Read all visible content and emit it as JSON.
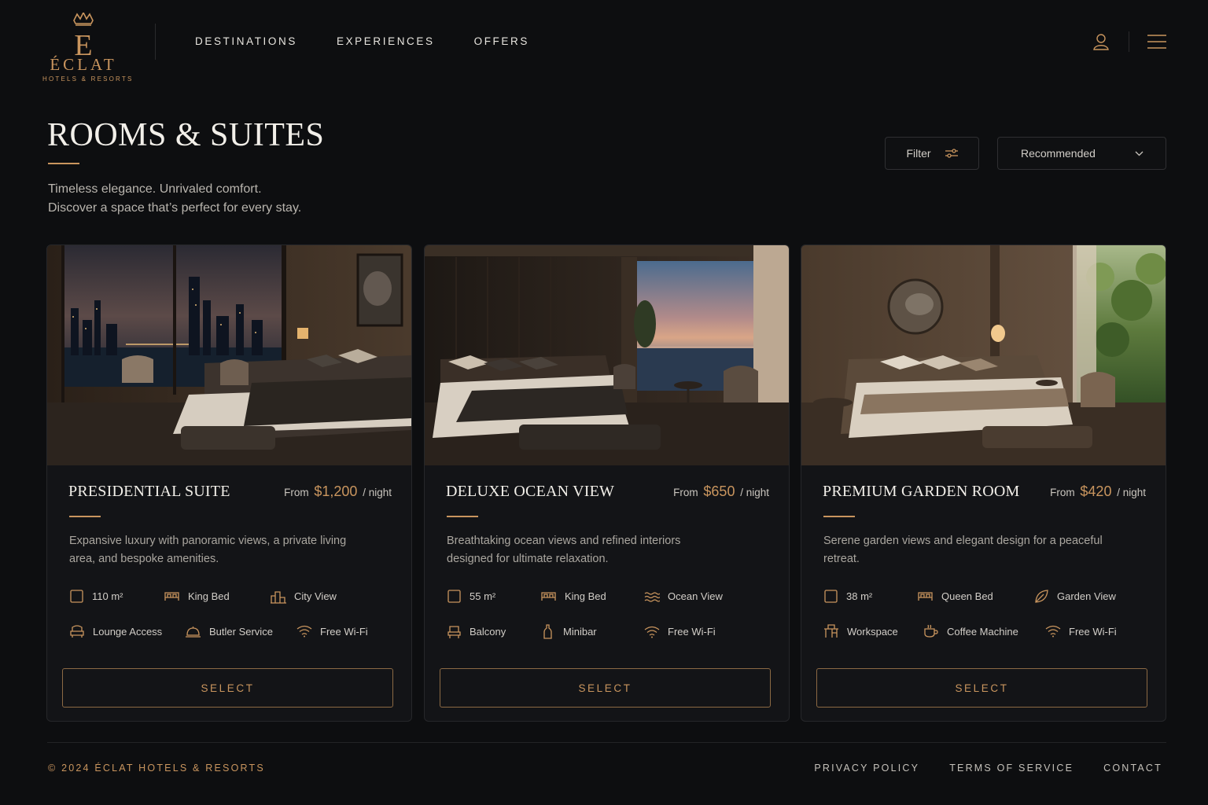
{
  "brand": {
    "name": "ÉCLAT",
    "tagline": "HOTELS & RESORTS",
    "accent_color": "#c9955e"
  },
  "nav": {
    "items": [
      {
        "label": "DESTINATIONS"
      },
      {
        "label": "EXPERIENCES"
      },
      {
        "label": "OFFERS"
      }
    ]
  },
  "header_icons": [
    "user-icon",
    "menu-icon"
  ],
  "page": {
    "title": "ROOMS & SUITES",
    "subtitle_line1": "Timeless elegance. Unrivaled comfort.",
    "subtitle_line2": "Discover a space that’s perfect for every stay."
  },
  "controls": {
    "filter_label": "Filter",
    "sort_value": "Recommended"
  },
  "rooms": [
    {
      "name": "PRESIDENTIAL SUITE",
      "price_prefix": "From",
      "price": "$1,200",
      "price_suffix": "/ night",
      "description": "Expansive luxury with panoramic views, a private living area, and bespoke amenities.",
      "image_scene": "city night view bedroom",
      "amenities_row1": [
        {
          "icon": "area-icon",
          "label": "110 m²"
        },
        {
          "icon": "bed-icon",
          "label": "King Bed"
        },
        {
          "icon": "city-icon",
          "label": "City View"
        }
      ],
      "amenities_row2": [
        {
          "icon": "lounge-icon",
          "label": "Lounge Access"
        },
        {
          "icon": "bell-icon",
          "label": "Butler Service"
        },
        {
          "icon": "wifi-icon",
          "label": "Free Wi-Fi"
        }
      ],
      "button_label": "SELECT"
    },
    {
      "name": "DELUXE OCEAN VIEW",
      "price_prefix": "From",
      "price": "$650",
      "price_suffix": "/ night",
      "description": "Breathtaking ocean views and refined interiors designed for ultimate relaxation.",
      "image_scene": "ocean sunset bedroom",
      "amenities_row1": [
        {
          "icon": "area-icon",
          "label": "55 m²"
        },
        {
          "icon": "bed-icon",
          "label": "King Bed"
        },
        {
          "icon": "waves-icon",
          "label": "Ocean View"
        }
      ],
      "amenities_row2": [
        {
          "icon": "chair-icon",
          "label": "Balcony"
        },
        {
          "icon": "bottle-icon",
          "label": "Minibar"
        },
        {
          "icon": "wifi-icon",
          "label": "Free Wi-Fi"
        }
      ],
      "button_label": "SELECT"
    },
    {
      "name": "PREMIUM GARDEN ROOM",
      "price_prefix": "From",
      "price": "$420",
      "price_suffix": "/ night",
      "description": "Serene garden views and elegant design for a peaceful retreat.",
      "image_scene": "garden view bedroom",
      "amenities_row1": [
        {
          "icon": "area-icon",
          "label": "38 m²"
        },
        {
          "icon": "bed-icon",
          "label": "Queen Bed"
        },
        {
          "icon": "leaf-icon",
          "label": "Garden View"
        }
      ],
      "amenities_row2": [
        {
          "icon": "desk-icon",
          "label": "Workspace"
        },
        {
          "icon": "coffee-icon",
          "label": "Coffee Machine"
        },
        {
          "icon": "wifi-icon",
          "label": "Free Wi-Fi"
        }
      ],
      "button_label": "SELECT"
    }
  ],
  "footer": {
    "copyright": "© 2024 ÉCLAT HOTELS & RESORTS",
    "links": [
      {
        "label": "PRIVACY POLICY"
      },
      {
        "label": "TERMS OF SERVICE"
      },
      {
        "label": "CONTACT"
      }
    ]
  }
}
